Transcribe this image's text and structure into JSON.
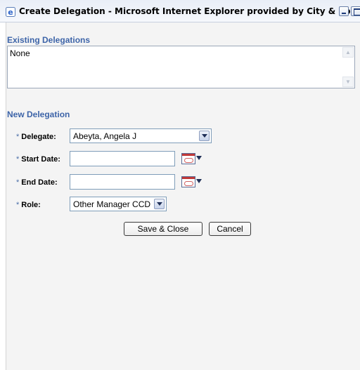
{
  "window": {
    "title": "Create Delegation - Microsoft Internet Explorer provided by City & Co..."
  },
  "existing": {
    "heading": "Existing Delegations",
    "value": "None"
  },
  "new_delegation": {
    "heading": "New Delegation",
    "required_marker": "*",
    "delegate_label": "Delegate:",
    "delegate_value": "Abeyta, Angela J",
    "start_date_label": "Start Date:",
    "start_date_value": "",
    "end_date_label": "End Date:",
    "end_date_value": "",
    "role_label": "Role:",
    "role_value": "Other Manager CCD"
  },
  "buttons": {
    "save_close": "Save & Close",
    "cancel": "Cancel"
  },
  "icons": {
    "app": "ie-icon",
    "calendar": "calendar-icon",
    "dropdown": "chevron-down-icon"
  }
}
